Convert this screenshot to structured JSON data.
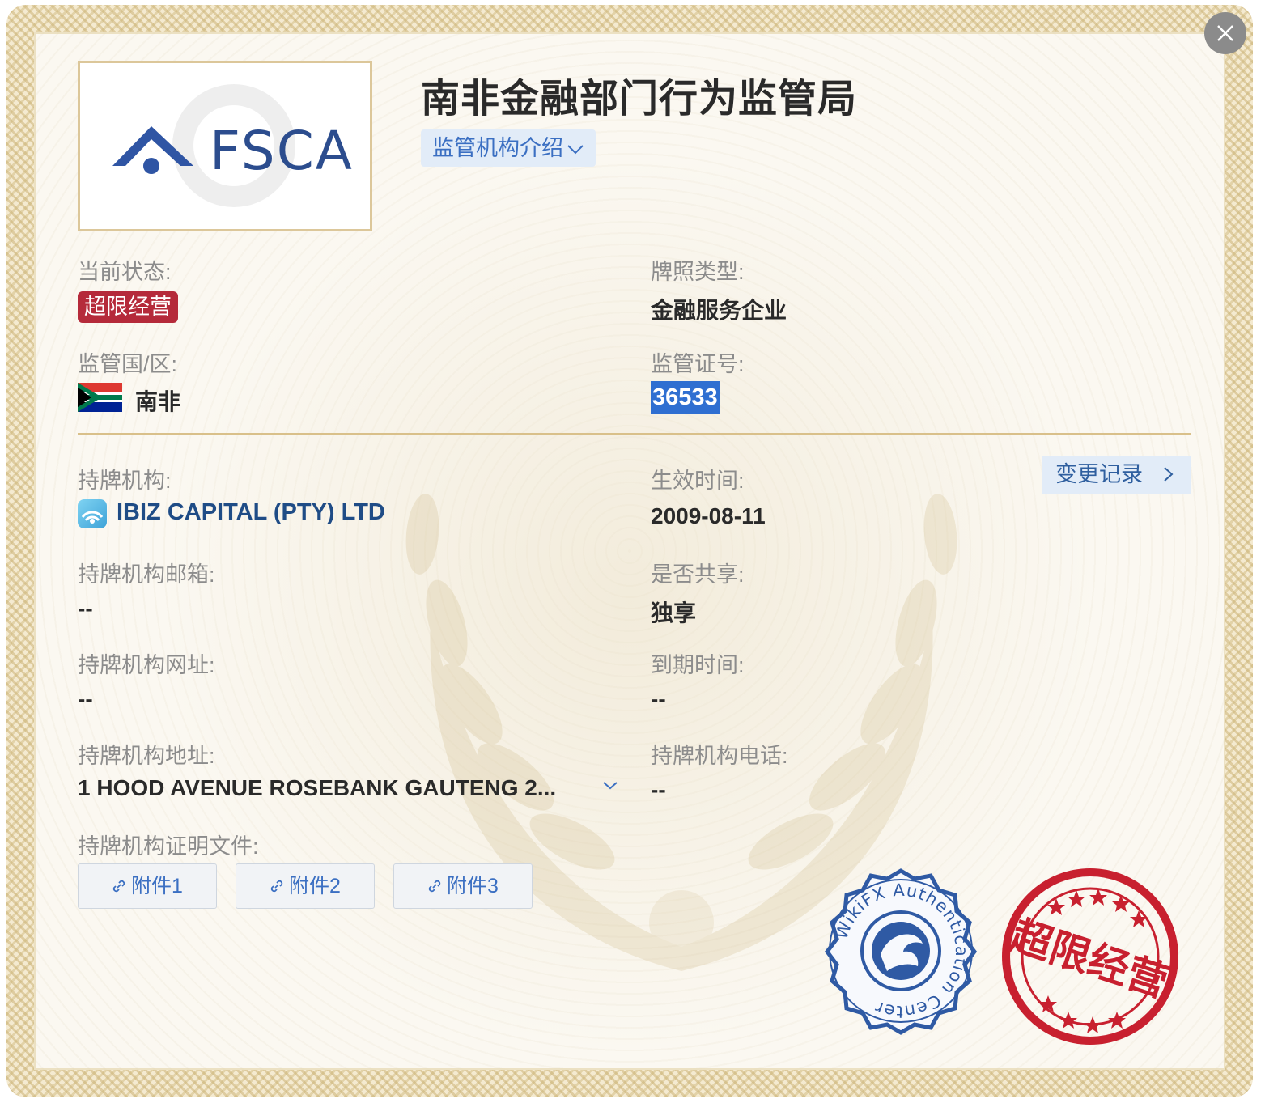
{
  "header": {
    "title": "南非金融部门行为监管局",
    "intro_button": "监管机构介绍"
  },
  "logo": {
    "text": "FSCA"
  },
  "status": {
    "label": "当前状态:",
    "badge": "超限经营"
  },
  "license_type": {
    "label": "牌照类型:",
    "value": "金融服务企业"
  },
  "region": {
    "label": "监管国/区:",
    "value": "南非"
  },
  "license_no": {
    "label": "监管证号:",
    "value": "36533"
  },
  "holder": {
    "label": "持牌机构:",
    "value": "IBIZ CAPITAL (PTY) LTD"
  },
  "effective_date": {
    "label": "生效时间:",
    "value": "2009-08-11"
  },
  "history_button": "变更记录",
  "email": {
    "label": "持牌机构邮箱:",
    "value": "--"
  },
  "shared": {
    "label": "是否共享:",
    "value": "独享"
  },
  "website": {
    "label": "持牌机构网址:",
    "value": "--"
  },
  "expiry": {
    "label": "到期时间:",
    "value": "--"
  },
  "address": {
    "label": "持牌机构地址:",
    "value": "1 HOOD AVENUE ROSEBANK GAUTENG 2..."
  },
  "phone": {
    "label": "持牌机构电话:",
    "value": "--"
  },
  "documents": {
    "label": "持牌机构证明文件:",
    "items": [
      "附件1",
      "附件2",
      "附件3"
    ]
  },
  "seals": {
    "wikifx_text": "WikiFX Authentication Center",
    "status_stamp": "超限经营"
  },
  "colors": {
    "accent_blue": "#3b6fc2",
    "status_red": "#b52a3a",
    "gold_border": "#d9c08a"
  },
  "icons": [
    "close-icon",
    "chevron-down-icon",
    "chevron-right-icon",
    "link-icon",
    "south-africa-flag-icon",
    "company-icon"
  ]
}
